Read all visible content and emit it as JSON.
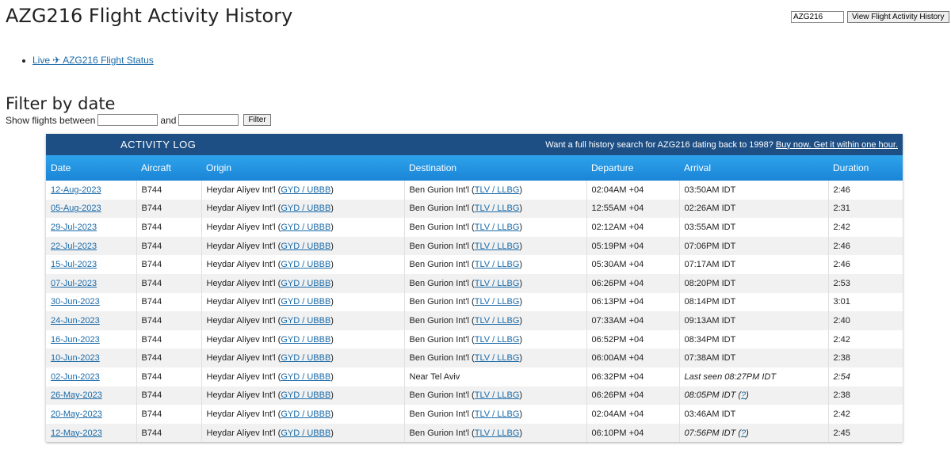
{
  "page": {
    "title": "AZG216 Flight Activity History"
  },
  "top_form": {
    "flight_value": "AZG216",
    "button_label": "View Flight Activity History"
  },
  "live_link": "Live ✈ AZG216 Flight Status",
  "filter": {
    "heading": "Filter by date",
    "label_prefix": "Show flights between",
    "label_and": "and",
    "button_label": "Filter"
  },
  "log": {
    "label": "ACTIVITY LOG",
    "promo_text": "Want a full history search for AZG216 dating back to 1998?",
    "promo_link": "Buy now. Get it within one hour."
  },
  "table": {
    "headers": [
      "Date",
      "Aircraft",
      "Origin",
      "Destination",
      "Departure",
      "Arrival",
      "Duration"
    ],
    "rows": [
      {
        "date": "12-Aug-2023",
        "aircraft": "B744",
        "origin_name": "Heydar Aliyev Int'l",
        "origin_code": "GYD / UBBB",
        "dest_name": "Ben Gurion Int'l",
        "dest_code": "TLV / LLBG",
        "departure": "02:04AM +04",
        "arrival": "03:50AM IDT",
        "arrival_style": "normal",
        "duration": "2:46"
      },
      {
        "date": "05-Aug-2023",
        "aircraft": "B744",
        "origin_name": "Heydar Aliyev Int'l",
        "origin_code": "GYD / UBBB",
        "dest_name": "Ben Gurion Int'l",
        "dest_code": "TLV / LLBG",
        "departure": "12:55AM +04",
        "arrival": "02:26AM IDT",
        "arrival_style": "normal",
        "duration": "2:31"
      },
      {
        "date": "29-Jul-2023",
        "aircraft": "B744",
        "origin_name": "Heydar Aliyev Int'l",
        "origin_code": "GYD / UBBB",
        "dest_name": "Ben Gurion Int'l",
        "dest_code": "TLV / LLBG",
        "departure": "02:12AM +04",
        "arrival": "03:55AM IDT",
        "arrival_style": "normal",
        "duration": "2:42"
      },
      {
        "date": "22-Jul-2023",
        "aircraft": "B744",
        "origin_name": "Heydar Aliyev Int'l",
        "origin_code": "GYD / UBBB",
        "dest_name": "Ben Gurion Int'l",
        "dest_code": "TLV / LLBG",
        "departure": "05:19PM +04",
        "arrival": "07:06PM IDT",
        "arrival_style": "normal",
        "duration": "2:46"
      },
      {
        "date": "15-Jul-2023",
        "aircraft": "B744",
        "origin_name": "Heydar Aliyev Int'l",
        "origin_code": "GYD / UBBB",
        "dest_name": "Ben Gurion Int'l",
        "dest_code": "TLV / LLBG",
        "departure": "05:30AM +04",
        "arrival": "07:17AM IDT",
        "arrival_style": "normal",
        "duration": "2:46"
      },
      {
        "date": "07-Jul-2023",
        "aircraft": "B744",
        "origin_name": "Heydar Aliyev Int'l",
        "origin_code": "GYD / UBBB",
        "dest_name": "Ben Gurion Int'l",
        "dest_code": "TLV / LLBG",
        "departure": "06:26PM +04",
        "arrival": "08:20PM IDT",
        "arrival_style": "normal",
        "duration": "2:53"
      },
      {
        "date": "30-Jun-2023",
        "aircraft": "B744",
        "origin_name": "Heydar Aliyev Int'l",
        "origin_code": "GYD / UBBB",
        "dest_name": "Ben Gurion Int'l",
        "dest_code": "TLV / LLBG",
        "departure": "06:13PM +04",
        "arrival": "08:14PM IDT",
        "arrival_style": "normal",
        "duration": "3:01"
      },
      {
        "date": "24-Jun-2023",
        "aircraft": "B744",
        "origin_name": "Heydar Aliyev Int'l",
        "origin_code": "GYD / UBBB",
        "dest_name": "Ben Gurion Int'l",
        "dest_code": "TLV / LLBG",
        "departure": "07:33AM +04",
        "arrival": "09:13AM IDT",
        "arrival_style": "normal",
        "duration": "2:40"
      },
      {
        "date": "16-Jun-2023",
        "aircraft": "B744",
        "origin_name": "Heydar Aliyev Int'l",
        "origin_code": "GYD / UBBB",
        "dest_name": "Ben Gurion Int'l",
        "dest_code": "TLV / LLBG",
        "departure": "06:52PM +04",
        "arrival": "08:34PM IDT",
        "arrival_style": "normal",
        "duration": "2:42"
      },
      {
        "date": "10-Jun-2023",
        "aircraft": "B744",
        "origin_name": "Heydar Aliyev Int'l",
        "origin_code": "GYD / UBBB",
        "dest_name": "Ben Gurion Int'l",
        "dest_code": "TLV / LLBG",
        "departure": "06:00AM +04",
        "arrival": "07:38AM IDT",
        "arrival_style": "normal",
        "duration": "2:38"
      },
      {
        "date": "02-Jun-2023",
        "aircraft": "B744",
        "origin_name": "Heydar Aliyev Int'l",
        "origin_code": "GYD / UBBB",
        "dest_name": "Near Tel Aviv",
        "dest_code": "",
        "departure": "06:32PM +04",
        "arrival": "Last seen 08:27PM IDT",
        "arrival_style": "italic",
        "duration": "2:54",
        "duration_style": "italic"
      },
      {
        "date": "26-May-2023",
        "aircraft": "B744",
        "origin_name": "Heydar Aliyev Int'l",
        "origin_code": "GYD / UBBB",
        "dest_name": "Ben Gurion Int'l",
        "dest_code": "TLV / LLBG",
        "departure": "06:26PM +04",
        "arrival": "08:05PM IDT",
        "arrival_style": "italic-q",
        "duration": "2:38"
      },
      {
        "date": "20-May-2023",
        "aircraft": "B744",
        "origin_name": "Heydar Aliyev Int'l",
        "origin_code": "GYD / UBBB",
        "dest_name": "Ben Gurion Int'l",
        "dest_code": "TLV / LLBG",
        "departure": "02:04AM +04",
        "arrival": "03:46AM IDT",
        "arrival_style": "normal",
        "duration": "2:42"
      },
      {
        "date": "12-May-2023",
        "aircraft": "B744",
        "origin_name": "Heydar Aliyev Int'l",
        "origin_code": "GYD / UBBB",
        "dest_name": "Ben Gurion Int'l",
        "dest_code": "TLV / LLBG",
        "departure": "06:10PM +04",
        "arrival": "07:56PM IDT",
        "arrival_style": "italic-q",
        "duration": "2:45"
      }
    ],
    "question_mark": "?"
  },
  "colors": {
    "log_bar": "#1d4f85",
    "header_gradient_top": "#2fa3ec",
    "header_gradient_bottom": "#1a85d6",
    "link": "#1a6aa8"
  }
}
